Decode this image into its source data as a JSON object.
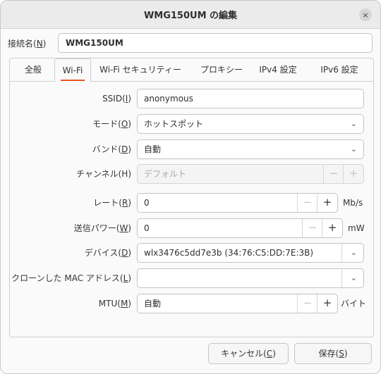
{
  "window": {
    "title": "WMG150UM の編集",
    "close_glyph": "×"
  },
  "connection": {
    "label_prefix": "接続名(",
    "label_key": "N",
    "label_suffix": ")",
    "value": "WMG150UM"
  },
  "tabs": [
    {
      "label": "全般",
      "active": false
    },
    {
      "label": "Wi-Fi",
      "active": true
    },
    {
      "label": "Wi-Fi セキュリティー",
      "active": false
    },
    {
      "label": "プロキシー",
      "active": false
    },
    {
      "label": "IPv4 設定",
      "active": false
    },
    {
      "label": "IPv6 設定",
      "active": false
    }
  ],
  "wifi": {
    "ssid": {
      "label_prefix": "SSID(",
      "label_key": "I",
      "label_suffix": ")",
      "value": "anonymous"
    },
    "mode": {
      "label_prefix": "モード(",
      "label_key": "O",
      "label_suffix": ")",
      "value": "ホットスポット"
    },
    "band": {
      "label_prefix": "バンド(",
      "label_key": "D",
      "label_suffix": ")",
      "value": "自動"
    },
    "channel": {
      "label": "チャンネル(H)",
      "placeholder": "デフォルト"
    },
    "rate": {
      "label_prefix": "レート(",
      "label_key": "R",
      "label_suffix": ")",
      "value": "0",
      "unit": "Mb/s"
    },
    "tx_power": {
      "label_prefix": "送信パワー(",
      "label_key": "W",
      "label_suffix": ")",
      "value": "0",
      "unit": "mW"
    },
    "device": {
      "label_prefix": "デバイス(",
      "label_key": "D",
      "label_suffix": ")",
      "value": "wlx3476c5dd7e3b (34:76:C5:DD:7E:3B)"
    },
    "cloned_mac": {
      "label_prefix": "クローンした MAC アドレス(",
      "label_key": "L",
      "label_suffix": ")",
      "value": ""
    },
    "mtu": {
      "label_prefix": "MTU(",
      "label_key": "M",
      "label_suffix": ")",
      "value": "自動",
      "unit": "バイト"
    }
  },
  "stepper": {
    "minus": "−",
    "plus": "+"
  },
  "dropdown_glyph": "⌄",
  "footer": {
    "cancel": {
      "prefix": "キャンセル(",
      "key": "C",
      "suffix": ")"
    },
    "save": {
      "prefix": "保存(",
      "key": "S",
      "suffix": ")"
    }
  }
}
